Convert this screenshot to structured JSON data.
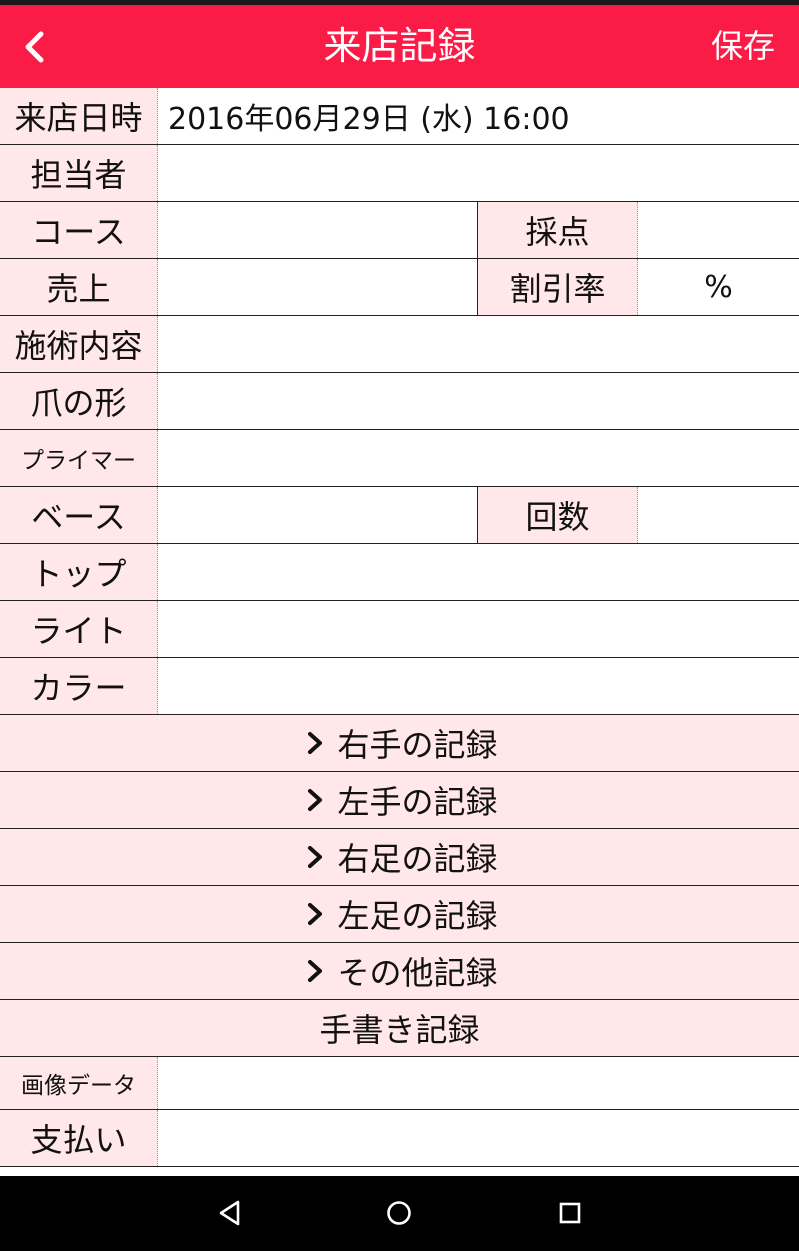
{
  "header": {
    "title": "来店記録",
    "save_label": "保存",
    "background": "#fb1b47"
  },
  "form": {
    "visit_datetime": {
      "label": "来店日時",
      "value": "2016年06月29日 (水) 16:00"
    },
    "staff": {
      "label": "担当者",
      "value": ""
    },
    "course": {
      "label": "コース",
      "value": ""
    },
    "score": {
      "label": "採点",
      "value": ""
    },
    "sales": {
      "label": "売上",
      "value": ""
    },
    "discount": {
      "label": "割引率",
      "value": "",
      "unit": "%"
    },
    "treatment": {
      "label": "施術内容",
      "value": ""
    },
    "nail_shape": {
      "label": "爪の形",
      "value": ""
    },
    "primer": {
      "label": "プライマー",
      "value": ""
    },
    "base": {
      "label": "ベース",
      "value": ""
    },
    "count": {
      "label": "回数",
      "value": ""
    },
    "top": {
      "label": "トップ",
      "value": ""
    },
    "light": {
      "label": "ライト",
      "value": ""
    },
    "color": {
      "label": "カラー",
      "value": ""
    }
  },
  "sections": [
    {
      "label": "右手の記録"
    },
    {
      "label": "左手の記録"
    },
    {
      "label": "右足の記録"
    },
    {
      "label": "左足の記録"
    },
    {
      "label": "その他記録"
    }
  ],
  "handwriting": {
    "label": "手書き記録"
  },
  "image_data": {
    "label": "画像データ",
    "value": ""
  },
  "payment": {
    "label": "支払い",
    "value": ""
  },
  "label_background": "#ffe7ea"
}
